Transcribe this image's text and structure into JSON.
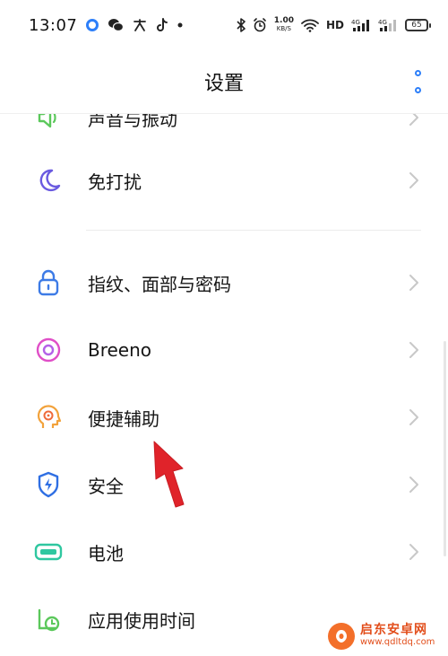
{
  "status_bar": {
    "time": "13:07",
    "net_speed": "1.00",
    "net_unit": "KB/S",
    "hd_label": "HD",
    "signal1_label": "4G",
    "signal2_label": "4G",
    "battery": "65"
  },
  "header": {
    "title": "设置"
  },
  "settings": {
    "items": [
      {
        "label": "声音与振动",
        "icon": "speaker-icon"
      },
      {
        "label": "免打扰",
        "icon": "moon-icon"
      },
      {
        "label": "指纹、面部与密码",
        "icon": "lock-icon"
      },
      {
        "label": "Breeno",
        "icon": "breeno-icon"
      },
      {
        "label": "便捷辅助",
        "icon": "assist-head-icon"
      },
      {
        "label": "安全",
        "icon": "shield-icon"
      },
      {
        "label": "电池",
        "icon": "battery-icon"
      },
      {
        "label": "应用使用时间",
        "icon": "clock-icon"
      }
    ]
  },
  "watermark": {
    "line1": "启东安卓网",
    "line2": "www.qdltdq.com"
  },
  "colors": {
    "accent": "#2d7ff9",
    "arrow": "#e0232a",
    "moon": "#6a5ae0",
    "lock": "#3d7be6",
    "breeno": "#e04fc7",
    "assist": "#f2a23b",
    "shield": "#2f6fe3",
    "battery": "#2fc7a0",
    "clock": "#5bc85b",
    "speaker": "#5bc85b"
  }
}
